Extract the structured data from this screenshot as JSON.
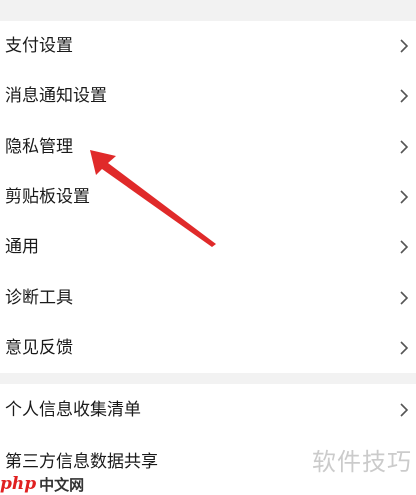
{
  "settings_group_1": {
    "items": [
      {
        "label": "支付设置"
      },
      {
        "label": "消息通知设置"
      },
      {
        "label": "隐私管理"
      },
      {
        "label": "剪贴板设置"
      },
      {
        "label": "通用"
      },
      {
        "label": "诊断工具"
      },
      {
        "label": "意见反馈"
      }
    ]
  },
  "settings_group_2": {
    "items": [
      {
        "label": "个人信息收集清单"
      },
      {
        "label": "第三方信息数据共享"
      }
    ]
  },
  "watermark": {
    "right_text": "软件技巧",
    "logo_text": "php",
    "site_text": "中文网"
  },
  "colors": {
    "arrow": "#e02a2a",
    "chevron": "#555555",
    "background": "#f2f2f2"
  }
}
